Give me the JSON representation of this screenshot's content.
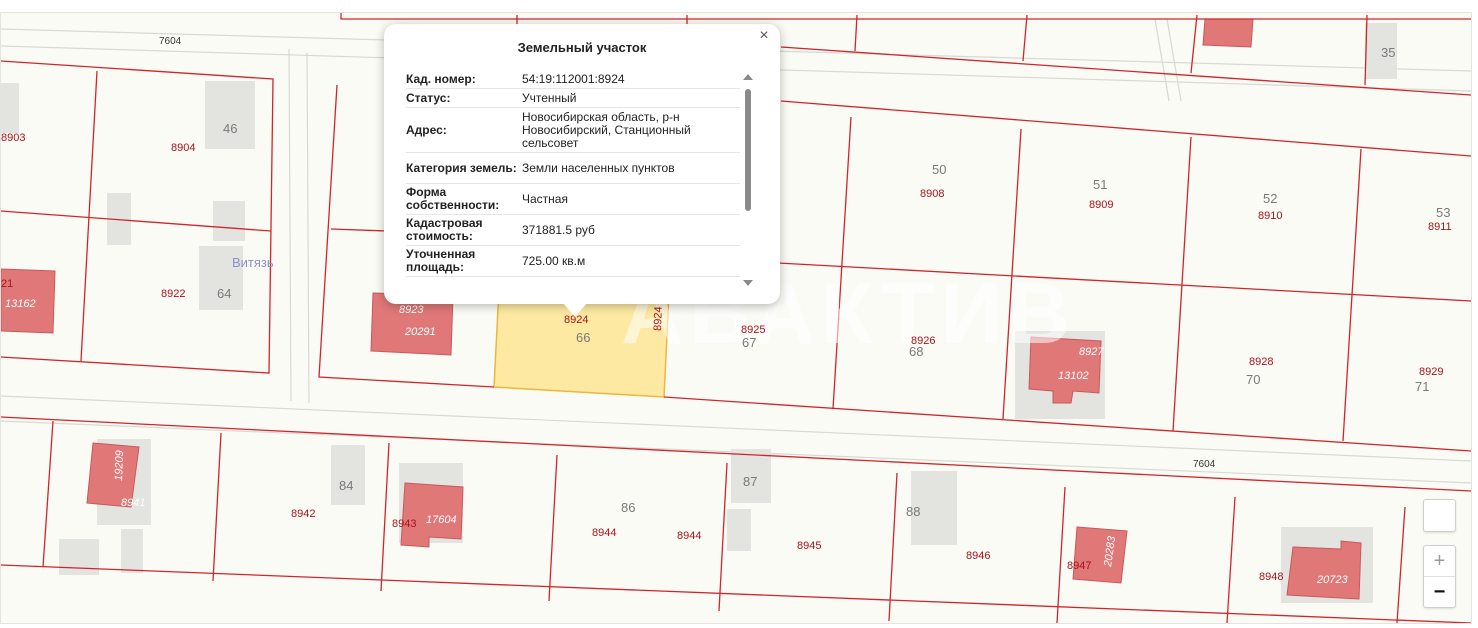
{
  "popup": {
    "title": "Земельный участок",
    "close_glyph": "×",
    "rows": [
      {
        "key": "Кад. номер:",
        "value": "54:19:112001:8924"
      },
      {
        "key": "Статус:",
        "value": "Учтенный"
      },
      {
        "key": "Адрес:",
        "value": "Новосибирская область, р-н Новосибирский, Станционный сельсовет"
      },
      {
        "key": "Категория земель:",
        "value": "Земли населенных пунктов"
      },
      {
        "key": "Форма собственности:",
        "value": "Частная"
      },
      {
        "key": "Кадастровая стоимость:",
        "value": "371881.5 руб"
      },
      {
        "key": "Уточненная площадь:",
        "value": "725.00 кв.м"
      }
    ]
  },
  "map": {
    "watermark": "АВАКТИВ",
    "place_name": "Витязь",
    "street_numbers": [
      "7604",
      "7604"
    ],
    "parcels": [
      "8903",
      "8904",
      "8922",
      "21",
      "8923",
      "8924",
      "8924",
      "8925",
      "8926",
      "8927",
      "8928",
      "8929",
      "8908",
      "8909",
      "8910",
      "8911",
      "8941",
      "8942",
      "8943",
      "8944",
      "8944",
      "8945",
      "8946",
      "8947",
      "8948"
    ],
    "buildings": [
      "13162",
      "20291",
      "13102",
      "19209",
      "17604",
      "20283",
      "20723"
    ],
    "house_numbers": [
      "35",
      "46",
      "64",
      "66",
      "67",
      "68",
      "50",
      "51",
      "52",
      "53",
      "70",
      "71",
      "84",
      "86",
      "87",
      "88"
    ],
    "colors": {
      "parcel_line": "#d0252b",
      "building": "#e07878",
      "selected": "#fde9a2",
      "selected_border": "#f0b53c",
      "background": "#fbfbf6"
    }
  },
  "controls": {
    "zoom_in": "+",
    "zoom_out": "−"
  }
}
